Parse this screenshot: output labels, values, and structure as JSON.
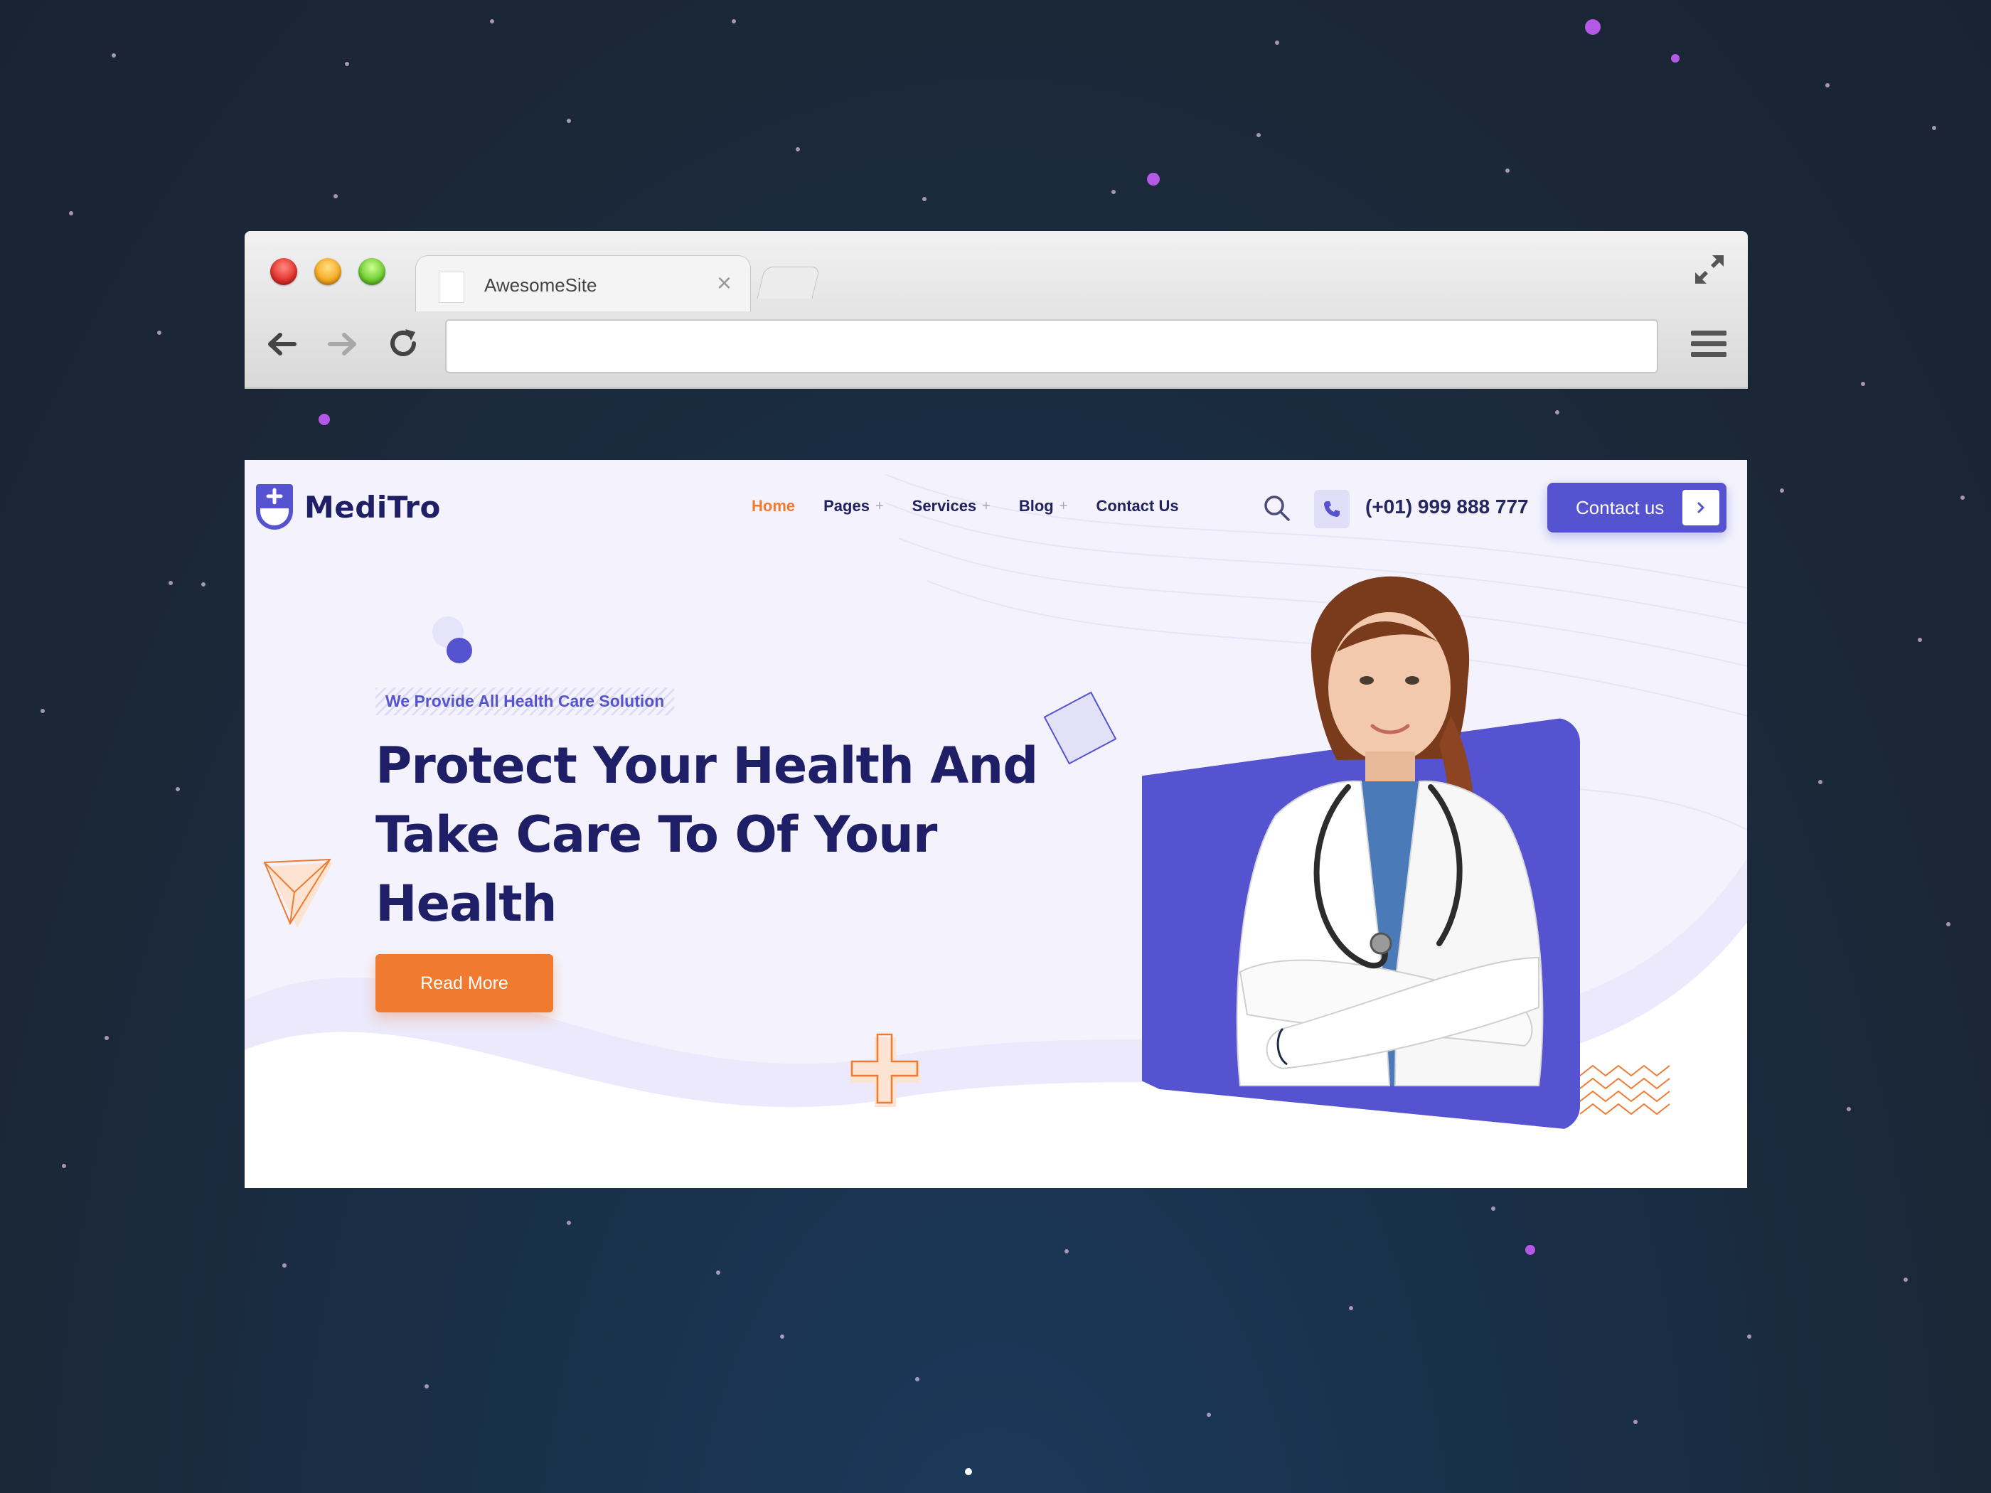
{
  "browser": {
    "tab_title": "AwesomeSite",
    "tab_close": "×",
    "url": ""
  },
  "site": {
    "brand": "MediTro",
    "nav": [
      {
        "label": "Home",
        "active": true,
        "has_submenu": false
      },
      {
        "label": "Pages",
        "active": false,
        "has_submenu": true
      },
      {
        "label": "Services",
        "active": false,
        "has_submenu": true
      },
      {
        "label": "Blog",
        "active": false,
        "has_submenu": true
      },
      {
        "label": "Contact Us",
        "active": false,
        "has_submenu": false
      }
    ],
    "submenu_marker": "+",
    "phone": "(+01) 999 888 777",
    "contact_button": "Contact us",
    "hero": {
      "tagline": "We Provide All Health Care Solution",
      "headline": "Protect Your Health And Take Care To Of Your Health",
      "cta": "Read More"
    }
  },
  "colors": {
    "brand_navy": "#1e1f66",
    "accent_purple": "#5553d0",
    "accent_orange": "#f07a2f",
    "page_bg": "#f4f3fd",
    "desktop_bg": "#1b2838"
  }
}
